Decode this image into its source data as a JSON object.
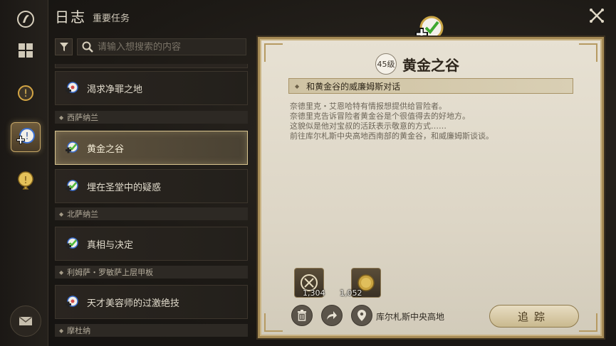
{
  "header": {
    "title": "日志",
    "subtitle": "重要任务"
  },
  "search": {
    "placeholder": "请输入想搜索的内容"
  },
  "quest_list": {
    "items": [
      {
        "label": "渴求净罪之地"
      },
      {
        "region": "西萨纳兰"
      },
      {
        "label": "黄金之谷",
        "selected": true
      },
      {
        "label": "埋在圣堂中的疑惑"
      },
      {
        "region": "北萨纳兰"
      },
      {
        "label": "真相与决定"
      },
      {
        "region": "利姆萨・罗敏萨上层甲板"
      },
      {
        "label": "天才美容师的过激绝技"
      },
      {
        "region": "摩杜纳"
      }
    ]
  },
  "detail": {
    "level": "45级",
    "title": "黄金之谷",
    "objective": "和黄金谷的威廉姆斯对话",
    "description": [
      "奈德里克・艾恩哈特有情报想提供给冒险者。",
      "奈德里克告诉冒险者黄金谷是个很值得去的好地方。",
      "这貌似是他对宝叔的活跃表示敬意的方式……",
      "前往库尔札斯中央高地西南部的黄金谷，和威廉姆斯谈谈。"
    ],
    "rewards": [
      {
        "icon": "experience-icon",
        "count": "1,304"
      },
      {
        "icon": "gil-coin-icon",
        "count": "1,052"
      }
    ],
    "location": "库尔札斯中央高地",
    "track_label": "追踪"
  },
  "colors": {
    "accent_gold": "#c9a968",
    "panel_bg": "#e7e1d3",
    "quest_green": "#4fb83a"
  }
}
